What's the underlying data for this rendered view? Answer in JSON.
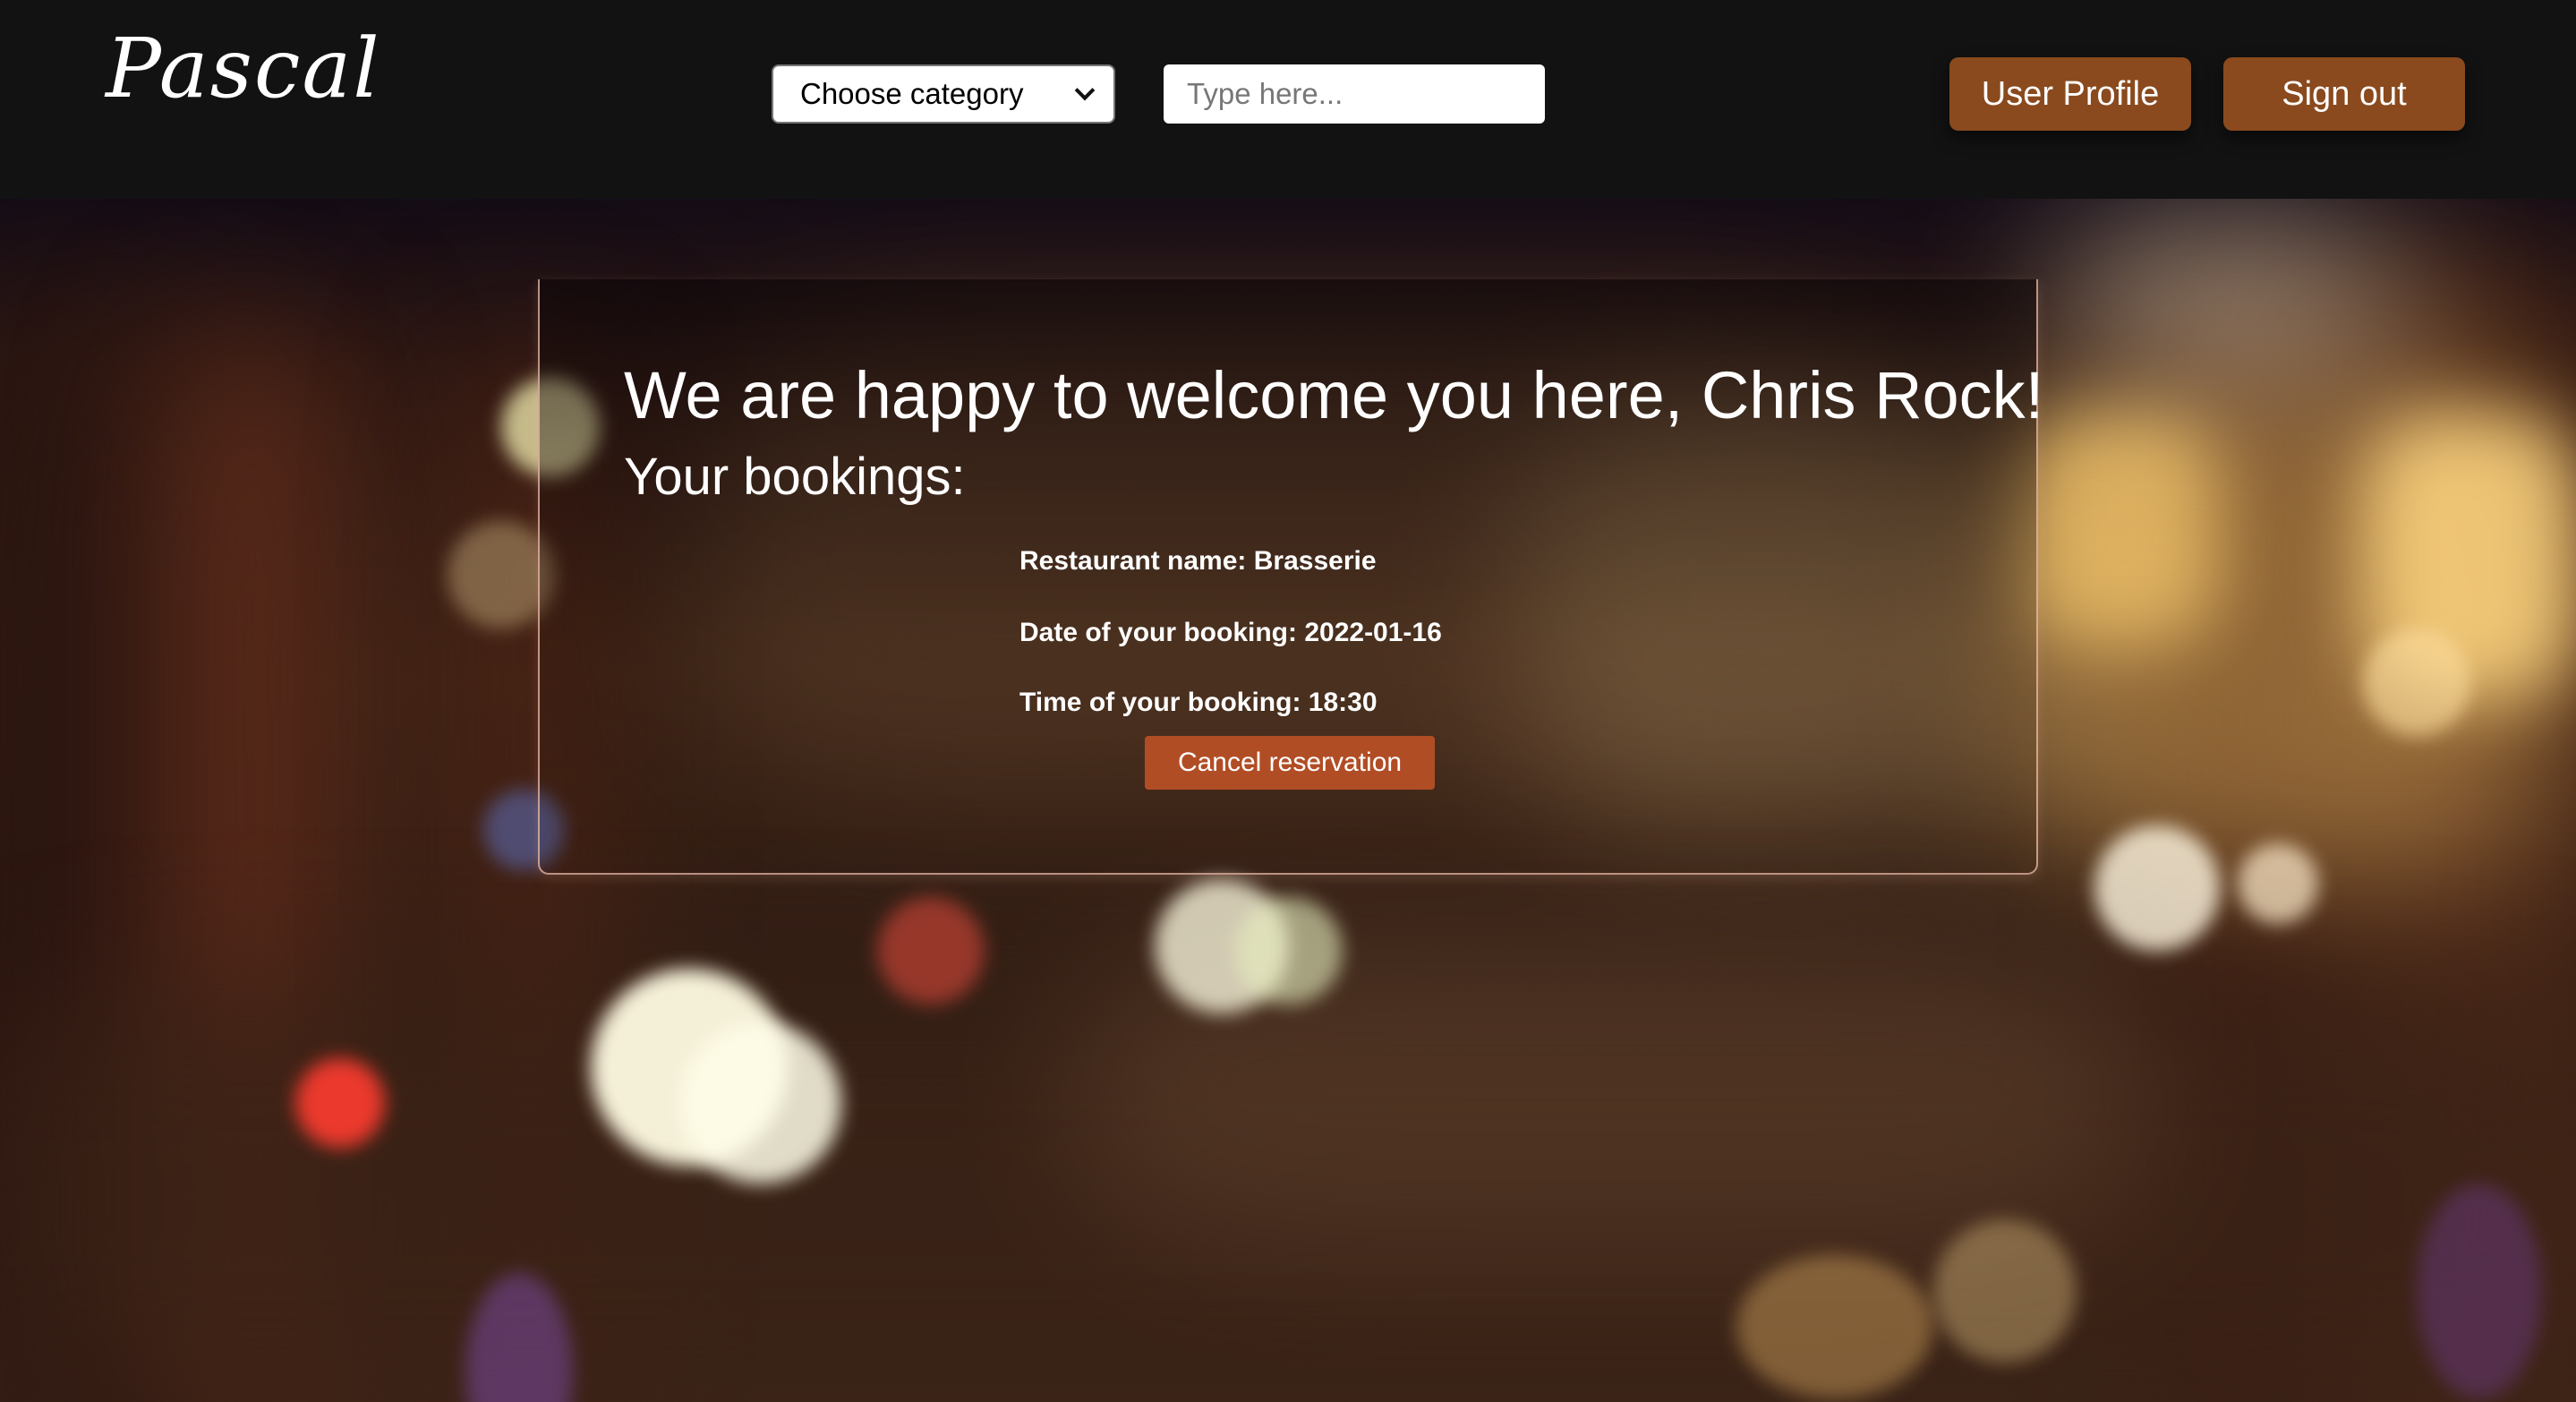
{
  "header": {
    "logo_text": "Pascal",
    "category_select": {
      "selected": "Choose category"
    },
    "search": {
      "placeholder": "Type here...",
      "value": ""
    },
    "user_profile_label": "User Profile",
    "sign_out_label": "Sign out"
  },
  "main": {
    "welcome_title": "We are happy to welcome you here, Chris Rock!",
    "bookings_heading": "Your bookings:",
    "booking": {
      "restaurant": "Restaurant name: Brasserie",
      "date": "Date of your booking: 2022-01-16",
      "time": "Time of your booking: 18:30",
      "cancel_label": "Cancel reservation"
    }
  },
  "colors": {
    "header_bg": "#121212",
    "header_button": "#8a4a1e",
    "cancel_button": "#b14d25",
    "panel_border": "#f0beaa"
  },
  "icons": {
    "select_arrow": "chevron-down-icon"
  }
}
